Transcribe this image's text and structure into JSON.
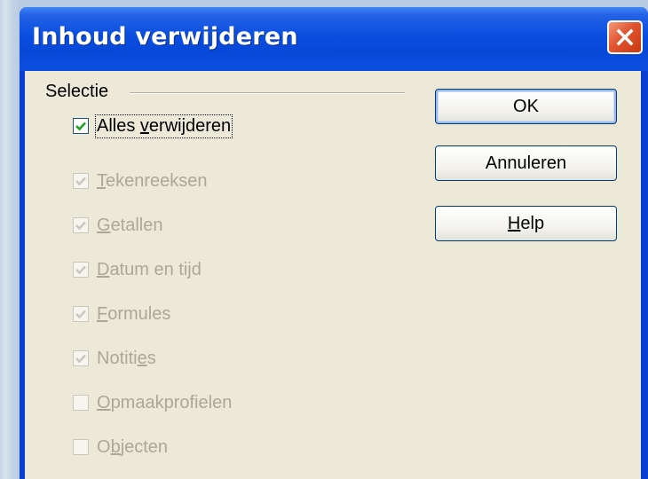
{
  "dialog": {
    "title": "Inhoud verwijderen",
    "close_icon": "close-icon"
  },
  "selection": {
    "group_label": "Selectie",
    "items": [
      {
        "label": "Alles verwijderen",
        "mnemonic": "v",
        "checked": true,
        "enabled": true
      },
      {
        "label": "Tekenreeksen",
        "mnemonic": "T",
        "checked": true,
        "enabled": false
      },
      {
        "label": "Getallen",
        "mnemonic": "G",
        "checked": true,
        "enabled": false
      },
      {
        "label": "Datum en tijd",
        "mnemonic": "D",
        "checked": true,
        "enabled": false
      },
      {
        "label": "Formules",
        "mnemonic": "F",
        "checked": true,
        "enabled": false
      },
      {
        "label": "Notities",
        "mnemonic": "e",
        "checked": true,
        "enabled": false
      },
      {
        "label": "Opmaakprofielen",
        "mnemonic": "O",
        "checked": false,
        "enabled": false
      },
      {
        "label": "Objecten",
        "mnemonic": "b",
        "checked": false,
        "enabled": false
      }
    ]
  },
  "buttons": {
    "ok": "OK",
    "cancel": "Annuleren",
    "help": "Help"
  },
  "colors": {
    "titlebar": "#0a4ee0",
    "checkmark_enabled": "#21a121",
    "checkmark_disabled": "#cac8bb",
    "disabled_text": "#aca899",
    "dialog_face": "#ece9d8",
    "close_button": "#e0542f"
  }
}
